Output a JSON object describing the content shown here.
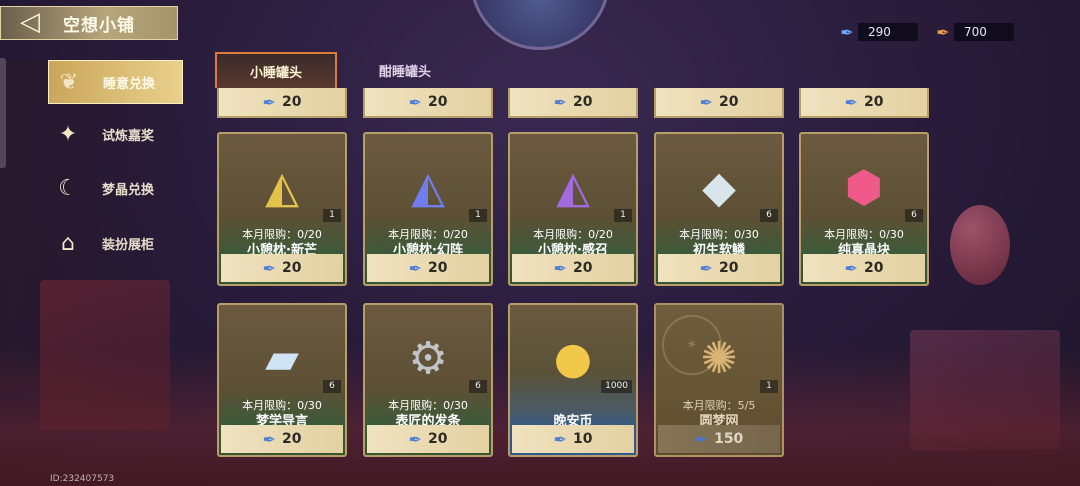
{
  "header": {
    "title": "空想小铺"
  },
  "currencies": [
    {
      "icon": "blue-feather-icon",
      "value": "290",
      "color": "#6fa8ff"
    },
    {
      "icon": "rainbow-feather-icon",
      "value": "700",
      "color": "#f29a4a"
    }
  ],
  "sidebar": {
    "items": [
      {
        "label": "睡意兑换",
        "active": true
      },
      {
        "label": "试炼嘉奖",
        "active": false
      },
      {
        "label": "梦晶兑换",
        "active": false
      },
      {
        "label": "装扮展柜",
        "active": false
      }
    ]
  },
  "tabs": [
    {
      "label": "小睡罐头",
      "active": true
    },
    {
      "label": "酣睡罐头",
      "active": false
    }
  ],
  "top_row_prices": [
    "20",
    "20",
    "20",
    "20",
    "20"
  ],
  "cards": [
    {
      "name": "小憩枕·新芒",
      "limit": "本月限购：0/20",
      "qty": "1",
      "price": "20",
      "icon": "triangle-gem-gold-icon"
    },
    {
      "name": "小憩枕·幻阵",
      "limit": "本月限购：0/20",
      "qty": "1",
      "price": "20",
      "icon": "triangle-gem-blue-icon"
    },
    {
      "name": "小憩枕·感召",
      "limit": "本月限购：0/20",
      "qty": "1",
      "price": "20",
      "icon": "triangle-gem-purple-icon"
    },
    {
      "name": "初生软鳞",
      "limit": "本月限购：0/30",
      "qty": "6",
      "price": "20",
      "icon": "scale-crystal-icon"
    },
    {
      "name": "纯真晶块",
      "limit": "本月限购：0/30",
      "qty": "6",
      "price": "20",
      "icon": "pink-crystal-icon"
    },
    {
      "name": "梦学导言",
      "limit": "本月限购：0/30",
      "qty": "6",
      "price": "20",
      "icon": "book-card-icon"
    },
    {
      "name": "表匠的发条",
      "limit": "本月限购：0/30",
      "qty": "6",
      "price": "20",
      "icon": "wind-up-key-icon"
    },
    {
      "name": "晚安币",
      "limit": "",
      "qty": "1000",
      "price": "10",
      "icon": "gold-coin-icon"
    },
    {
      "name": "圆梦网",
      "limit": "本月限购：5/5",
      "qty": "1",
      "price": "150",
      "icon": "dreamcatcher-icon",
      "sold_out": true
    }
  ],
  "footer": {
    "uid": "ID:232407573"
  }
}
